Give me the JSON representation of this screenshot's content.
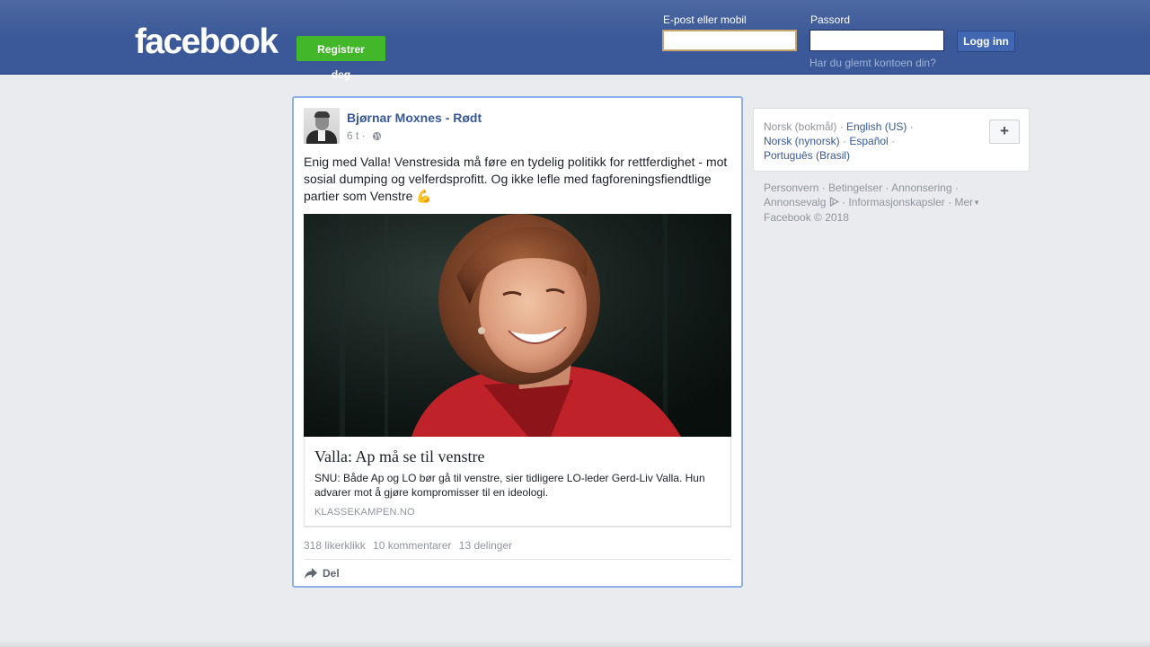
{
  "header": {
    "logo": "facebook",
    "register_label": "Registrer deg",
    "email_label": "E-post eller mobil",
    "email_value": "",
    "password_label": "Passord",
    "password_value": "",
    "login_label": "Logg inn",
    "forgot_label": "Har du glemt kontoen din?"
  },
  "post": {
    "author": "Bjørnar Moxnes - Rødt",
    "time": "6 t",
    "separator": " · ",
    "privacy_icon": "globe-icon",
    "text": "Enig med Valla! Venstresida må føre en tydelig politikk for rettferdighet - mot sosial dumping og velferdsprofitt. Og ikke lefle med fagforeningsfiendtlige partier som Venstre",
    "text_emoji": "💪",
    "link": {
      "title": "Valla: Ap må se til venstre",
      "description": "SNU: Både Ap og LO bør gå til venstre, sier tidligere LO-leder Gerd-Liv Valla. Hun advarer mot å gjøre kompromisser til en ideologi.",
      "domain": "KLASSEKAMPEN.NO"
    },
    "stats": {
      "likes": "318 likerklikk",
      "comments": "10 kommentarer",
      "shares": "13 delinger"
    },
    "share_label": "Del"
  },
  "languages": {
    "current": "Norsk (bokmål)",
    "options": [
      "English (US)",
      "Norsk (nynorsk)",
      "Español",
      "Português (Brasil)"
    ],
    "add_label": "+"
  },
  "footer": {
    "links": [
      "Personvern",
      "Betingelser",
      "Annonsering",
      "Annonsevalg",
      "Informasjonskapsler",
      "Mer"
    ],
    "copyright": "Facebook © 2018"
  },
  "colors": {
    "brand_blue": "#3b5998",
    "register_green": "#42b72a",
    "link_blue": "#365899",
    "muted_gray": "#90949c",
    "page_bg": "#e9ebee"
  }
}
